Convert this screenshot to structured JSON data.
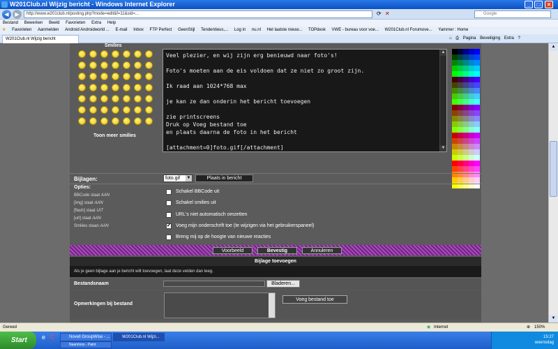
{
  "window": {
    "title": "W201Club.nl Wijzig bericht - Windows Internet Explorer"
  },
  "address": {
    "url": "http://www.w201club.nl/posting.php?mode=edit&f=11&sid=...",
    "search_placeholder": "Google"
  },
  "menu": [
    "Bestand",
    "Bewerken",
    "Beeld",
    "Favorieten",
    "Extra",
    "Help"
  ],
  "favorites": [
    "Favorieten",
    "Aanmelden",
    "Android Androidworld ...",
    "E-mail",
    "Inbox",
    "FTP Perfect",
    "GeenStijl",
    "Tendentieus,...",
    "Log in",
    "nu.nl",
    "Het laatste nieuw...",
    "TOPdesk",
    "VWE - bureau voor voe...",
    "W201Club.nl Forumove...",
    "Yammer : Home"
  ],
  "tab": {
    "label": "W201Club.nl Wijzig bericht"
  },
  "tools": [
    "Pagina",
    "Beveiliging",
    "Extra"
  ],
  "smilies": {
    "title": "Smilies",
    "more": "Toon meer smilies"
  },
  "editor": {
    "lines": [
      "Veel plezier, en wij zijn erg benieuwd naar foto's!",
      "",
      "Foto's moeten aan de eis voldoen dat ze niet zo groot zijn.",
      "",
      "Ik raad aan 1024*768 max",
      "",
      "je kan ze dan onderin het bericht toevoegen",
      "",
      "zie printscreens",
      "Druk op  Voeg bestand toe",
      "en plaats daarna de foto in het bericht",
      "",
      "[attachment=0]foto.gif[/attachment]"
    ]
  },
  "bijlagen": {
    "label": "Bijlagen:",
    "selected": "foto.gif",
    "button": "Plaats in bericht"
  },
  "opties": {
    "title": "Opties:",
    "status": [
      {
        "name": "BBCode staat ",
        "state": "AAN"
      },
      {
        "name": "[img] staat ",
        "state": "AAN"
      },
      {
        "name": "[flash] staat ",
        "state": "UIT"
      },
      {
        "name": "[url] staat ",
        "state": "AAN"
      },
      {
        "name": "Smilies staan ",
        "state": "AAN"
      }
    ],
    "checkboxes": [
      {
        "label": "Schakel BBCode uit",
        "checked": false
      },
      {
        "label": "Schakel smilies uit",
        "checked": false
      },
      {
        "label": "URL's niet automatisch omzetten",
        "checked": false
      },
      {
        "label": "Voeg mijn onderschrift toe (te wijzigen via het gebruikerspaneel)",
        "checked": true
      },
      {
        "label": "Breng mij op de hoogte van nieuwe reacties",
        "checked": false
      }
    ]
  },
  "buttons": {
    "preview": "Voorbeeld",
    "confirm": "Bevestig",
    "cancel": "Annuleren"
  },
  "attachment": {
    "header": "Bijlage toevoegen",
    "description": "Als je geen bijlage aan je bericht wilt toevoegen, laat deze velden dan leeg.",
    "filename_label": "Bestandsnaam",
    "browse": "Bladeren...",
    "comment_label": "Opmerkingen bij bestand",
    "add_button": "Voeg bestand toe"
  },
  "statusbar": {
    "left": "Gereed",
    "zone": "Internet",
    "zoom": "150%"
  },
  "taskbar": {
    "start": "Start",
    "items": [
      "Novell GroupWise - ...",
      "W201Club.nl Wijzi...",
      "Naamloos - Paint"
    ],
    "time": "15:27",
    "day": "woensdag"
  },
  "colors": {
    "editor_bg": "#181818",
    "panel_bg": "#5b5b5b",
    "button_bar": "#7a1f8a"
  },
  "palette": [
    "#000000",
    "#000044",
    "#000088",
    "#0000cc",
    "#0000ff",
    "#004400",
    "#004444",
    "#004488",
    "#0044cc",
    "#0044ff",
    "#008800",
    "#008844",
    "#008888",
    "#0088cc",
    "#0088ff",
    "#00cc00",
    "#00cc44",
    "#00cc88",
    "#00cccc",
    "#00ccff",
    "#00ff00",
    "#00ff44",
    "#00ff88",
    "#00ffcc",
    "#00ffff",
    "#440000",
    "#440044",
    "#440088",
    "#4400cc",
    "#4400ff",
    "#444400",
    "#444444",
    "#444488",
    "#4444cc",
    "#4444ff",
    "#448800",
    "#448844",
    "#448888",
    "#4488cc",
    "#4488ff",
    "#44cc00",
    "#44cc44",
    "#44cc88",
    "#44cccc",
    "#44ccff",
    "#44ff00",
    "#44ff44",
    "#44ff88",
    "#44ffcc",
    "#44ffff",
    "#880000",
    "#880044",
    "#880088",
    "#8800cc",
    "#8800ff",
    "#884400",
    "#884444",
    "#884488",
    "#8844cc",
    "#8844ff",
    "#888800",
    "#888844",
    "#888888",
    "#8888cc",
    "#8888ff",
    "#88cc00",
    "#88cc44",
    "#88cc88",
    "#88cccc",
    "#88ccff",
    "#88ff00",
    "#88ff44",
    "#88ff88",
    "#88ffcc",
    "#88ffff",
    "#cc0000",
    "#cc0044",
    "#cc0088",
    "#cc00cc",
    "#cc00ff",
    "#cc4400",
    "#cc4444",
    "#cc4488",
    "#cc44cc",
    "#cc44ff",
    "#cc8800",
    "#cc8844",
    "#cc8888",
    "#cc88cc",
    "#cc88ff",
    "#cccc00",
    "#cccc44",
    "#cccc88",
    "#cccccc",
    "#ccccff",
    "#ccff00",
    "#ccff44",
    "#ccff88",
    "#ccffcc",
    "#ccffff",
    "#ff0000",
    "#ff0044",
    "#ff0088",
    "#ff00cc",
    "#ff00ff",
    "#ff4400",
    "#ff4444",
    "#ff4488",
    "#ff44cc",
    "#ff44ff",
    "#ff8800",
    "#ff8844",
    "#ff8888",
    "#ff88cc",
    "#ff88ff",
    "#ffcc00",
    "#ffcc44",
    "#ffcc88",
    "#ffcccc",
    "#ffccff",
    "#ffff00",
    "#ffff44",
    "#ffff88",
    "#ffffcc",
    "#ffffff"
  ]
}
